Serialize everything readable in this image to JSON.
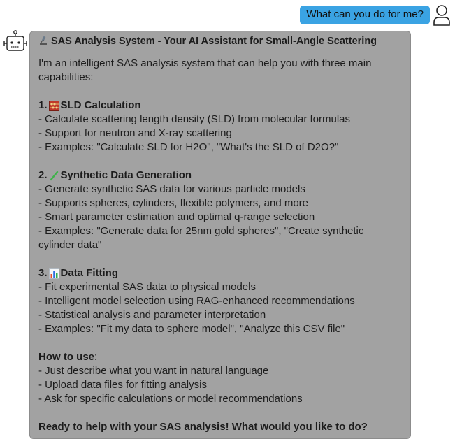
{
  "user_message": "What can you do for me?",
  "bot": {
    "title": "SAS Analysis System - Your AI Assistant for Small-Angle Scattering",
    "intro": "I'm an intelligent SAS analysis system that can help you with three main capabilities:",
    "sections": [
      {
        "number": "1.",
        "icon": "abacus-icon",
        "heading": "SLD Calculation",
        "items": [
          "- Calculate scattering length density (SLD) from molecular formulas",
          "- Support for neutron and X-ray scattering",
          "- Examples: \"Calculate SLD for H2O\", \"What's the SLD of D2O?\""
        ]
      },
      {
        "number": "2.",
        "icon": "check-icon",
        "heading": "Synthetic Data Generation",
        "items": [
          "- Generate synthetic SAS data for various particle models",
          "- Supports spheres, cylinders, flexible polymers, and more",
          "- Smart parameter estimation and optimal q-range selection",
          "- Examples: \"Generate data for 25nm gold spheres\", \"Create synthetic cylinder data\""
        ]
      },
      {
        "number": "3.",
        "icon": "bar-chart-icon",
        "heading": "Data Fitting",
        "items": [
          "- Fit experimental SAS data to physical models",
          "- Intelligent model selection using RAG-enhanced recommendations",
          "- Statistical analysis and parameter interpretation",
          "- Examples: \"Fit my data to sphere model\", \"Analyze this CSV file\""
        ]
      }
    ],
    "how_to_heading": "How to use",
    "how_to_colon": ":",
    "how_to_items": [
      "- Just describe what you want in natural language",
      "- Upload data files for fitting analysis",
      "- Ask for specific calculations or model recommendations"
    ],
    "closing": "Ready to help with your SAS analysis! What would you like to do?"
  },
  "colors": {
    "user_bubble": "#3aa3e3",
    "bot_bubble": "#a2a2a2"
  }
}
